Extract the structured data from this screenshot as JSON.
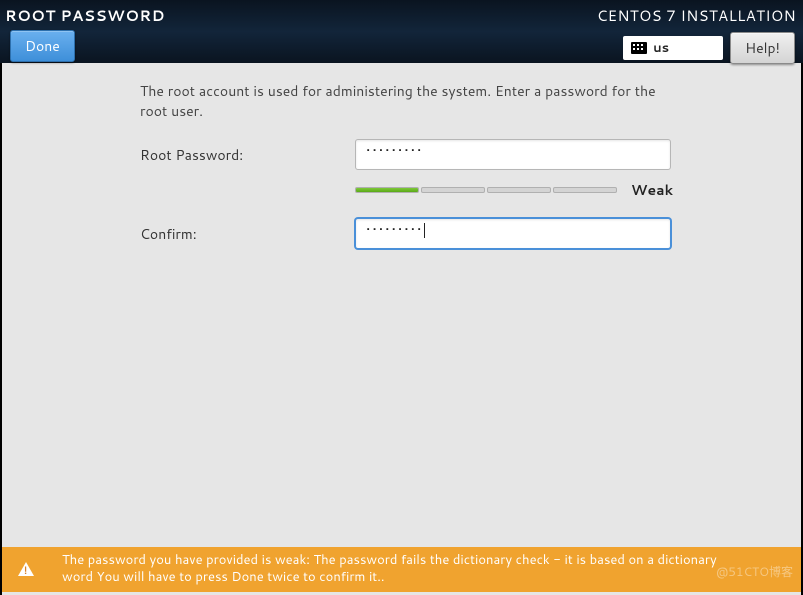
{
  "header": {
    "page_title": "ROOT PASSWORD",
    "done_label": "Done",
    "install_title": "CENTOS 7 INSTALLATION",
    "keyboard_layout": "us",
    "help_label": "Help!"
  },
  "form": {
    "intro": "The root account is used for administering the system.  Enter a password for the root user.",
    "password_label": "Root Password:",
    "confirm_label": "Confirm:",
    "password_value": "•••••••••",
    "confirm_value": "•••••••••",
    "strength_label": "Weak"
  },
  "warning": {
    "message": "The password you have provided is weak: The password fails the dictionary check - it is based on a dictionary word You will have to press Done twice to confirm it.."
  },
  "watermark": "@51CTO博客"
}
